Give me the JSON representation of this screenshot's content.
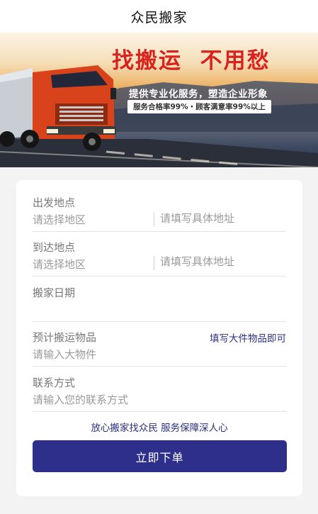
{
  "header": {
    "title": "众民搬家"
  },
  "banner": {
    "headline": "找搬运  不用愁",
    "subline": "提供专业化服务，塑造企业形象",
    "stats": "服务合格率99%・顾客满意率99%以上"
  },
  "form": {
    "origin": {
      "label": "出发地点",
      "region_placeholder": "请选择地区",
      "address_placeholder": "请填写具体地址"
    },
    "destination": {
      "label": "到达地点",
      "region_placeholder": "请选择地区",
      "address_placeholder": "请填写具体地址"
    },
    "date": {
      "label": "搬家日期",
      "value": ""
    },
    "items": {
      "label": "预计搬运物品",
      "hint_link": "填写大件物品即可",
      "placeholder": "请输入大物件"
    },
    "contact": {
      "label": "联系方式",
      "placeholder": "请输入您的联系方式"
    },
    "slogan": "放心搬家找众民 服务保障深人心",
    "submit_label": "立即下单"
  },
  "colors": {
    "accent": "#2e2f8a",
    "headline_red": "#d8231c",
    "page_bg": "#f3f3f3"
  }
}
